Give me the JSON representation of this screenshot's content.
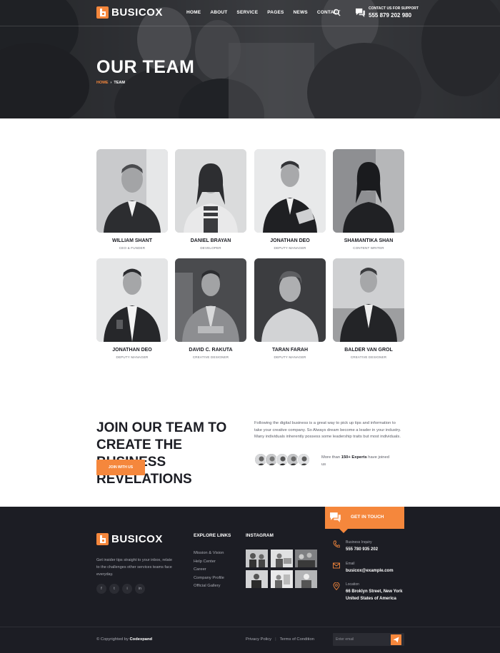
{
  "brand": {
    "name": "BUSICOX",
    "accent": "#f5873c",
    "dark": "#1c1d24"
  },
  "nav": {
    "items": [
      "HOME",
      "ABOUT",
      "SERVICE",
      "PAGES",
      "NEWS",
      "CONTACT"
    ]
  },
  "header": {
    "support_label": "CONTACT US FOR SUPPORT",
    "support_phone": "555 879 202 980"
  },
  "hero": {
    "title": "OUR TEAM",
    "breadcrumb_home": "HOME",
    "breadcrumb_separator": "›",
    "breadcrumb_current": "TEAM"
  },
  "team": [
    {
      "name": "WILLIAM SHANT",
      "role": "CEO & FUNDER"
    },
    {
      "name": "DANIEL BRAYAN",
      "role": "DEVELOPER"
    },
    {
      "name": "JONATHAN DEO",
      "role": "DEPUTY MANAGER"
    },
    {
      "name": "SHAMANTIKA SHAN",
      "role": "CONTENT WRITER"
    },
    {
      "name": "JONATHAN DEO",
      "role": "DEPUTY MANAGER"
    },
    {
      "name": "DAVID C. RAKUTA",
      "role": "CREATIVE DESIGNER"
    },
    {
      "name": "TARAN FARAH",
      "role": "DEPUTY MANAGER"
    },
    {
      "name": "BALDER VAN GROL",
      "role": "CREATIVE DESIGNER"
    }
  ],
  "join": {
    "title": "JOIN OUR TEAM TO CREATE THE BUSINESS REVELATIONS",
    "button": "JOIN WITH US",
    "text": "Following the digital business is a great way to pick up tips and information to take your creative company. So Always dream become a leader in your industry. Many individuals inherently possess some leadership traits but most individuals.",
    "experts_prefix": "More than",
    "experts_count": "150+ Experts",
    "experts_suffix": "have joined us"
  },
  "footer": {
    "get_in_touch": "GET IN TOUCH",
    "description": "Get insider tips straight to your inbox, relate to the challenges other services teams face everyday.",
    "socials": [
      "f",
      "t",
      "i",
      "in"
    ],
    "explore_heading": "EXPLORE LINKS",
    "explore_links": [
      "Mission & Vision",
      "Help Center",
      "Career",
      "Company Profile",
      "Official Gallery"
    ],
    "instagram_heading": "INSTAGRAM",
    "contact": [
      {
        "label": "Business Inquiry",
        "value": "555 780 935 202"
      },
      {
        "label": "Email",
        "value": "busicox@example.com"
      },
      {
        "label": "Location",
        "value": "66 Broklyn Street, New York United States of America"
      }
    ],
    "copyright_prefix": "© Copyrighted by",
    "copyright_brand": "Codexpand",
    "privacy": "Privacy Policy",
    "policy_divider": "|",
    "terms": "Terms of Condition",
    "email_placeholder": "Enter email"
  }
}
